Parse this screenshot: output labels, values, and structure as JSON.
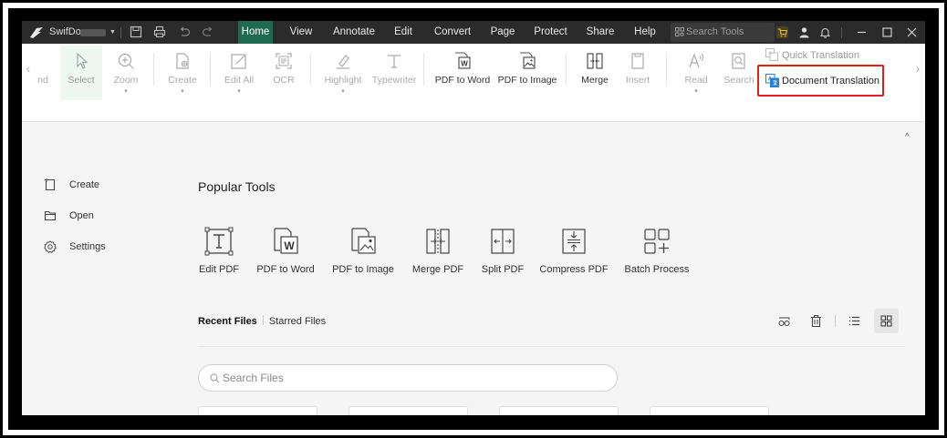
{
  "app": {
    "name": "SwifDoo",
    "accent": "#1f6b51",
    "highlight": "#e02020"
  },
  "tabs": [
    {
      "label": "Home",
      "active": true
    },
    {
      "label": "View"
    },
    {
      "label": "Annotate"
    },
    {
      "label": "Edit"
    },
    {
      "label": "Convert"
    },
    {
      "label": "Page"
    },
    {
      "label": "Protect"
    },
    {
      "label": "Share"
    },
    {
      "label": "Help"
    }
  ],
  "search_tools": {
    "placeholder": "Search Tools"
  },
  "ribbon": {
    "partial_label": "nd",
    "select": "Select",
    "zoom": "Zoom",
    "create": "Create",
    "edit_all": "Edit All",
    "ocr": "OCR",
    "highlight": "Highlight",
    "typewriter": "Typewriter",
    "pdf_to_word": "PDF to Word",
    "pdf_to_image": "PDF to Image",
    "merge": "Merge",
    "insert": "Insert",
    "read": "Read",
    "search": "Search",
    "quick_translation": "Quick Translation",
    "document_translation": "Document Translation"
  },
  "nav": [
    {
      "label": "Create",
      "icon": "create-file-icon"
    },
    {
      "label": "Open",
      "icon": "folder-icon"
    },
    {
      "label": "Settings",
      "icon": "gear-icon"
    }
  ],
  "popular": {
    "title": "Popular Tools",
    "tools": [
      {
        "label": "Edit PDF",
        "icon": "edit-pdf-icon"
      },
      {
        "label": "PDF to Word",
        "icon": "pdf-to-word-icon"
      },
      {
        "label": "PDF to Image",
        "icon": "pdf-to-image-icon"
      },
      {
        "label": "Merge PDF",
        "icon": "merge-pdf-icon"
      },
      {
        "label": "Split PDF",
        "icon": "split-pdf-icon"
      },
      {
        "label": "Compress PDF",
        "icon": "compress-pdf-icon"
      },
      {
        "label": "Batch Process",
        "icon": "batch-process-icon"
      }
    ]
  },
  "recent": {
    "recent_label": "Recent Files",
    "starred_label": "Starred Files",
    "search_placeholder": "Search Files"
  }
}
